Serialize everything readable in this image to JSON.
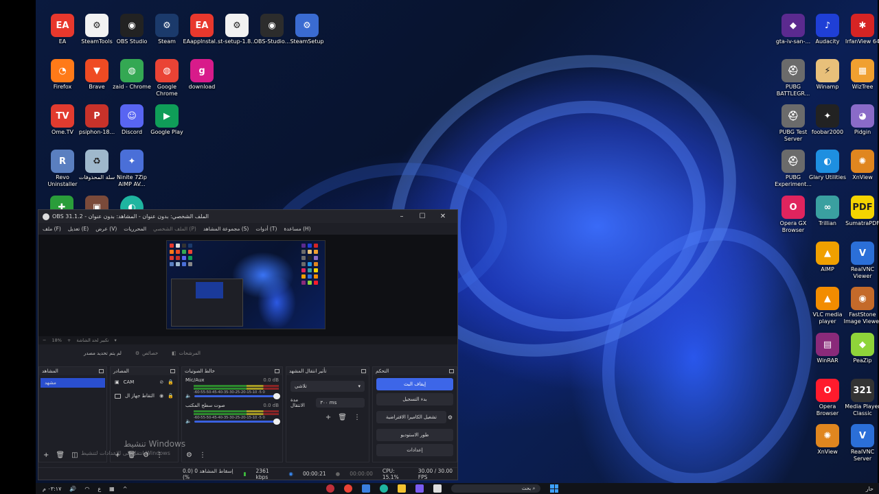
{
  "desktop_left_icons": [
    {
      "label": "EA",
      "icon": "ea-icon",
      "color": "#e8382d",
      "glyph": "EA"
    },
    {
      "label": "SteamTools",
      "icon": "steam-icon",
      "color": "#f2f2f2",
      "glyph": "⚙"
    },
    {
      "label": "OBS Studio",
      "icon": "obs-icon",
      "color": "#222222",
      "glyph": "◉"
    },
    {
      "label": "Steam",
      "icon": "steam-icon",
      "color": "#1b3a6b",
      "glyph": "⚙"
    },
    {
      "label": "EAappInstal...",
      "icon": "ea-icon",
      "color": "#e8382d",
      "glyph": "EA"
    },
    {
      "label": "st-setup-1.8...",
      "icon": "steam-icon",
      "color": "#f2f2f2",
      "glyph": "⚙"
    },
    {
      "label": "OBS-Studio...",
      "icon": "obs-icon",
      "color": "#2c2c2c",
      "glyph": "◉"
    },
    {
      "label": "SteamSetup",
      "icon": "steam-setup-icon",
      "color": "#3a6bd1",
      "glyph": "⚙"
    },
    {
      "label": "Firefox",
      "icon": "firefox-icon",
      "color": "#ff7a18",
      "glyph": "◔"
    },
    {
      "label": "Brave",
      "icon": "brave-icon",
      "color": "#ef4b23",
      "glyph": "▼"
    },
    {
      "label": "zaid - Chrome",
      "icon": "chrome-icon",
      "color": "#34a853",
      "glyph": "◍"
    },
    {
      "label": "Google Chrome",
      "icon": "chrome-icon",
      "color": "#ea4335",
      "glyph": "◍"
    },
    {
      "label": "download",
      "icon": "download-icon",
      "color": "#d81b8a",
      "glyph": "g"
    },
    {
      "label": "Ome.TV",
      "icon": "ometv-icon",
      "color": "#e23b2f",
      "glyph": "TV"
    },
    {
      "label": "psiphon-18...",
      "icon": "psiphon-icon",
      "color": "#c8322a",
      "glyph": "P"
    },
    {
      "label": "Discord",
      "icon": "discord-icon",
      "color": "#5865f2",
      "glyph": "☺"
    },
    {
      "label": "Google Play",
      "icon": "google-play-icon",
      "color": "#0f9d58",
      "glyph": "▶"
    },
    {
      "label": "Revo Uninstaller",
      "icon": "revo-icon",
      "color": "#5a7fc0",
      "glyph": "R"
    },
    {
      "label": "سلة المحذوفات",
      "icon": "recycle-bin-icon",
      "color": "#9fb8cc",
      "glyph": "♻"
    },
    {
      "label": "Ninite 7Zip AIMP AV...",
      "icon": "ninite-icon",
      "color": "#4a6fd8",
      "glyph": "✦"
    }
  ],
  "desktop_right_icons": [
    {
      "label": "gta-iv-san-...",
      "icon": "gta-icon",
      "color": "#5b2a8f",
      "glyph": "◆"
    },
    {
      "label": "Audacity",
      "icon": "audacity-icon",
      "color": "#1f3fd6",
      "glyph": "♪"
    },
    {
      "label": "IrfanView 64",
      "icon": "irfanview-icon",
      "color": "#d62424",
      "glyph": "✱"
    },
    {
      "label": "PUBG BATTLEGR...",
      "icon": "pubg-icon",
      "color": "#6b6b6b",
      "glyph": "⛑"
    },
    {
      "label": "Winamp",
      "icon": "winamp-icon",
      "color": "#e8c07a",
      "glyph": "⚡"
    },
    {
      "label": "WizTree",
      "icon": "wiztree-icon",
      "color": "#f0a030",
      "glyph": "▦"
    },
    {
      "label": "PUBG Test Server",
      "icon": "pubg-icon",
      "color": "#6b6b6b",
      "glyph": "⛑"
    },
    {
      "label": "foobar2000",
      "icon": "foobar-icon",
      "color": "#222222",
      "glyph": "✦"
    },
    {
      "label": "Pidgin",
      "icon": "pidgin-icon",
      "color": "#8a6bc8",
      "glyph": "◕"
    },
    {
      "label": "PUBG Experiment...",
      "icon": "pubg-icon",
      "color": "#6b6b6b",
      "glyph": "⛑"
    },
    {
      "label": "Glary Utilities",
      "icon": "glary-icon",
      "color": "#1e8fe0",
      "glyph": "◐"
    },
    {
      "label": "XnView",
      "icon": "xnview-icon",
      "color": "#e0861f",
      "glyph": "✺"
    },
    {
      "label": "Opera GX Browser",
      "icon": "opera-gx-icon",
      "color": "#e0245e",
      "glyph": "O"
    },
    {
      "label": "Trillian",
      "icon": "trillian-icon",
      "color": "#3aa0a0",
      "glyph": "∞"
    },
    {
      "label": "SumatraPDF",
      "icon": "sumatrapdf-icon",
      "color": "#f5d400",
      "glyph": "PDF"
    },
    {
      "label": "AIMP",
      "icon": "aimp-icon",
      "color": "#f0a000",
      "glyph": "▲"
    },
    {
      "label": "RealVNC Viewer",
      "icon": "realvnc-icon",
      "color": "#2b6fd8",
      "glyph": "V"
    },
    {
      "label": "VLC media player",
      "icon": "vlc-icon",
      "color": "#f28c00",
      "glyph": "▲"
    },
    {
      "label": "FastStone Image Viewer",
      "icon": "faststone-icon",
      "color": "#c46a2a",
      "glyph": "◉"
    },
    {
      "label": "WinRAR",
      "icon": "winrar-icon",
      "color": "#8a2a7a",
      "glyph": "▤"
    },
    {
      "label": "PeaZip",
      "icon": "peazip-icon",
      "color": "#8fd43a",
      "glyph": "◆"
    },
    {
      "label": "Opera Browser",
      "icon": "opera-icon",
      "color": "#ff1b2d",
      "glyph": "O"
    },
    {
      "label": "Media Player Classic",
      "icon": "mpc-icon",
      "color": "#333333",
      "glyph": "321"
    },
    {
      "label": "XnView",
      "icon": "xnview-icon",
      "color": "#e0861f",
      "glyph": "✺"
    },
    {
      "label": "RealVNC Server",
      "icon": "realvnc-icon",
      "color": "#2b6fd8",
      "glyph": "V"
    }
  ],
  "obs": {
    "title": "OBS 31.1.2 - الملف الشخصي: بدون عنوان - المشاهد: بدون عنوان",
    "menu": [
      "ملف (F)",
      "تعديل (E)",
      "عرض (V)",
      "المحرريات",
      "الملف الشخصي (P)",
      "مجموعة المشاهد (S)",
      "أدوات (T)",
      "مساعدة (H)"
    ],
    "zoom": "18%",
    "zoom_hint": "تكبير لحد الشاشة",
    "toolbar": {
      "no_source": "لم يتم تحديد مصدر",
      "properties": "خصائص",
      "filters": "المرشحات"
    },
    "docks": {
      "scenes": {
        "title": "المشاهد",
        "items": [
          "مشهد"
        ]
      },
      "sources": {
        "title": "المصادر",
        "items": [
          {
            "label": "CAM",
            "icon": "camera-icon"
          },
          {
            "label": "التقاط جهاز ال",
            "icon": "monitor-icon"
          }
        ]
      },
      "mixer": {
        "title": "خالط الصوتيات",
        "tracks": [
          {
            "name": "Mic/Aux",
            "db": "0.0 dB"
          },
          {
            "name": "صوت سطح المكتب",
            "db": "0.0 dB"
          }
        ],
        "scale": "-60-55-50-45-40-35-30-25-20-15-10 -5 0"
      },
      "transitions": {
        "title": "تأثير انتقال المشهد",
        "selected": "تلاشي",
        "duration_label": "مدة الانتقال",
        "duration": "٣٠٠ ms"
      },
      "controls": {
        "title": "التحكم",
        "buttons": [
          {
            "label": "إيقاف البث",
            "active": true
          },
          {
            "label": "بدء التسجيل",
            "active": false
          },
          {
            "label": "تشغيل الكاميرا الافتراضية",
            "active": false
          },
          {
            "label": "طور الاستوديو",
            "active": false
          },
          {
            "label": "إعدادات",
            "active": false
          }
        ]
      }
    },
    "status": {
      "dropped": "إسقاط المشاهد 0 (0.0 %)",
      "bitrate": "2361 kbps",
      "stream_time": "00:00:21",
      "rec_time": "00:00:00",
      "cpu": "CPU: 15.1%",
      "fps": "30.00 / 30.00 FPS"
    }
  },
  "watermark": {
    "line1": "تنشيط Windows",
    "line2": "انتقل إلى الإعدادات لتنشيط Windows"
  },
  "taskbar": {
    "time": "٠٣:١٧ م",
    "lang": "ع",
    "search": "بحث",
    "weather": "حار"
  }
}
